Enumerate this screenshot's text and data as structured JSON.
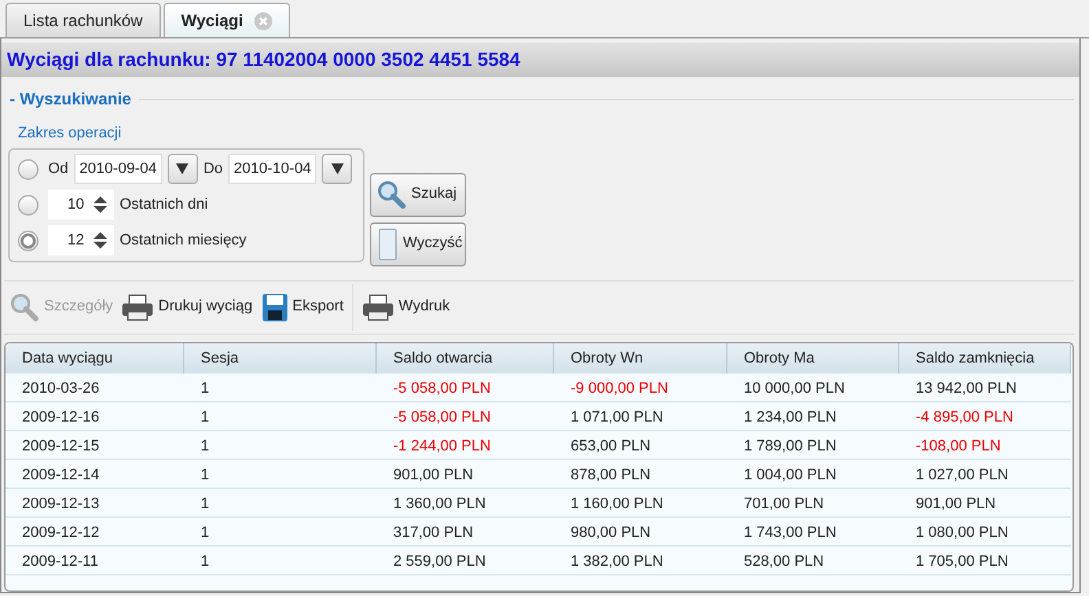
{
  "tabs": [
    {
      "label": "Lista rachunków",
      "selected": false
    },
    {
      "label": "Wyciągi",
      "selected": true
    }
  ],
  "header": {
    "title": "Wyciągi dla rachunku: 97 11402004 0000 3502 4451 5584"
  },
  "search": {
    "section": "- Wyszukiwanie",
    "group_label": "Zakres operacji",
    "options": [
      {
        "kind": "dates",
        "selected": false,
        "from_label": "Od",
        "from": "2010-09-04",
        "to_label": "Do",
        "to": "2010-10-04"
      },
      {
        "kind": "spinner",
        "selected": false,
        "value": "10",
        "label": "Ostatnich dni"
      },
      {
        "kind": "spinner",
        "selected": true,
        "value": "12",
        "label": "Ostatnich miesięcy"
      }
    ],
    "buttons": [
      {
        "label": "Szukaj"
      },
      {
        "label": "Wyczyść"
      }
    ]
  },
  "toolbar": [
    {
      "label": "Szczegóły",
      "disabled": true
    },
    {
      "label": "Drukuj wyciąg",
      "disabled": false
    },
    {
      "label": "Eksport",
      "disabled": false
    },
    {
      "label": "Wydruk",
      "disabled": false
    }
  ],
  "table": {
    "columns": [
      "Data wyciągu",
      "Sesja",
      "Saldo otwarcia",
      "Obroty Wn",
      "Obroty Ma",
      "Saldo zamknięcia"
    ],
    "rows": [
      [
        {
          "text": "2010-03-26",
          "negative": false
        },
        {
          "text": "1",
          "negative": false
        },
        {
          "text": "-5 058,00 PLN",
          "negative": true
        },
        {
          "text": "-9 000,00 PLN",
          "negative": true
        },
        {
          "text": "10 000,00 PLN",
          "negative": false
        },
        {
          "text": "13 942,00 PLN",
          "negative": false
        }
      ],
      [
        {
          "text": "2009-12-16",
          "negative": false
        },
        {
          "text": "1",
          "negative": false
        },
        {
          "text": "-5 058,00 PLN",
          "negative": true
        },
        {
          "text": "1 071,00 PLN",
          "negative": false
        },
        {
          "text": "1 234,00 PLN",
          "negative": false
        },
        {
          "text": "-4 895,00 PLN",
          "negative": true
        }
      ],
      [
        {
          "text": "2009-12-15",
          "negative": false
        },
        {
          "text": "1",
          "negative": false
        },
        {
          "text": "-1 244,00 PLN",
          "negative": true
        },
        {
          "text": "653,00 PLN",
          "negative": false
        },
        {
          "text": "1 789,00 PLN",
          "negative": false
        },
        {
          "text": "-108,00 PLN",
          "negative": true
        }
      ],
      [
        {
          "text": "2009-12-14",
          "negative": false
        },
        {
          "text": "1",
          "negative": false
        },
        {
          "text": "901,00 PLN",
          "negative": false
        },
        {
          "text": "878,00 PLN",
          "negative": false
        },
        {
          "text": "1 004,00 PLN",
          "negative": false
        },
        {
          "text": "1 027,00 PLN",
          "negative": false
        }
      ],
      [
        {
          "text": "2009-12-13",
          "negative": false
        },
        {
          "text": "1",
          "negative": false
        },
        {
          "text": "1 360,00 PLN",
          "negative": false
        },
        {
          "text": "1 160,00 PLN",
          "negative": false
        },
        {
          "text": "701,00 PLN",
          "negative": false
        },
        {
          "text": "901,00 PLN",
          "negative": false
        }
      ],
      [
        {
          "text": "2009-12-12",
          "negative": false
        },
        {
          "text": "1",
          "negative": false
        },
        {
          "text": "317,00 PLN",
          "negative": false
        },
        {
          "text": "980,00 PLN",
          "negative": false
        },
        {
          "text": "1 743,00 PLN",
          "negative": false
        },
        {
          "text": "1 080,00 PLN",
          "negative": false
        }
      ],
      [
        {
          "text": "2009-12-11",
          "negative": false
        },
        {
          "text": "1",
          "negative": false
        },
        {
          "text": "2 559,00 PLN",
          "negative": false
        },
        {
          "text": "1 382,00 PLN",
          "negative": false
        },
        {
          "text": "528,00 PLN",
          "negative": false
        },
        {
          "text": "1 705,00 PLN",
          "negative": false
        }
      ]
    ]
  }
}
